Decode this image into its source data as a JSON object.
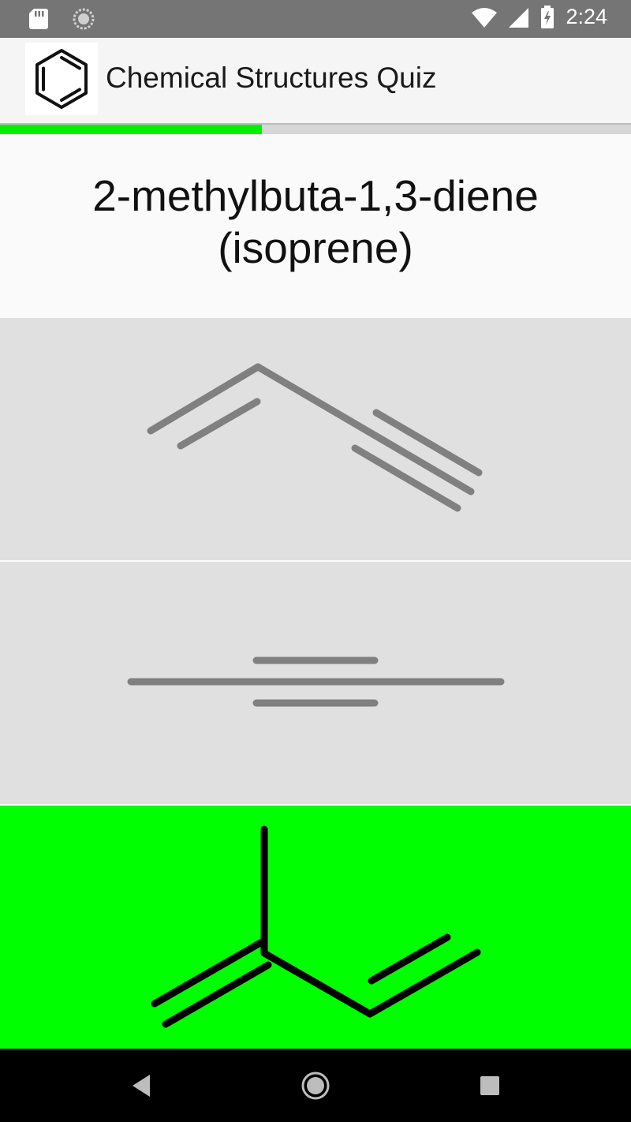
{
  "status_bar": {
    "time": "2:24",
    "icons": [
      "sd-card-icon",
      "sync-icon",
      "wifi-icon",
      "signal-icon",
      "battery-icon"
    ]
  },
  "app_bar": {
    "title": "Chemical Structures Quiz",
    "logo_icon": "benzene-icon"
  },
  "quiz": {
    "progress_fraction": 0.415,
    "question_line1": "2-methylbuta-1,3-diene",
    "question_line2": "(isoprene)",
    "options": [
      {
        "structure": "but-1-en-3-yne",
        "state": "default"
      },
      {
        "structure": "but-2-yne",
        "state": "default"
      },
      {
        "structure": "2-methylbuta-1,3-diene",
        "state": "correct"
      }
    ]
  },
  "colors": {
    "correct": "#00ff00",
    "progress": "#00f000",
    "option_background": "#e0e0e0",
    "status_bar": "#757575",
    "nav_bar": "#000000"
  },
  "nav_bar": {
    "buttons": [
      "back-icon",
      "home-icon",
      "recents-icon"
    ]
  }
}
